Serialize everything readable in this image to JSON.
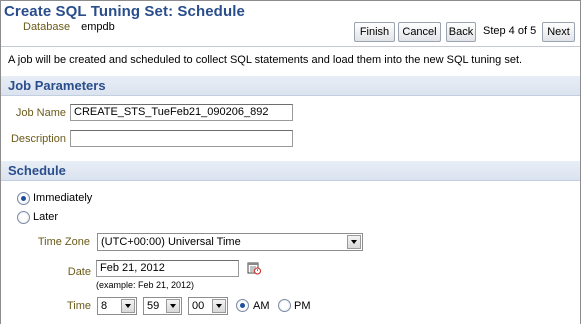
{
  "header": {
    "title": "Create SQL Tuning Set: Schedule",
    "database_label": "Database",
    "database_value": "empdb"
  },
  "toolbar": {
    "finish_label": "Finish",
    "cancel_label": "Cancel",
    "back_label": "Back",
    "step_text": "Step 4 of 5",
    "next_label": "Next"
  },
  "intro_text": "A job will be created and scheduled to collect SQL statements and load them into the new SQL tuning set.",
  "job_parameters": {
    "section_title": "Job Parameters",
    "job_name_label": "Job Name",
    "job_name_value": "CREATE_STS_TueFeb21_090206_892",
    "description_label": "Description",
    "description_value": ""
  },
  "schedule": {
    "section_title": "Schedule",
    "immediately_label": "Immediately",
    "immediately_selected": true,
    "later_label": "Later",
    "later_selected": false,
    "time_zone_label": "Time Zone",
    "time_zone_value": "(UTC+00:00) Universal Time",
    "date_label": "Date",
    "date_value": "Feb 21, 2012",
    "date_example": "(example: Feb 21, 2012)",
    "calendar_icon": "calendar-icon",
    "time_label": "Time",
    "hour_value": "8",
    "minute_value": "59",
    "second_value": "00",
    "am_label": "AM",
    "am_selected": true,
    "pm_label": "PM",
    "pm_selected": false
  },
  "colors": {
    "title_blue": "#2a4e8c",
    "label_olive": "#6a5a18",
    "section_bg": "#dbe3ef"
  }
}
